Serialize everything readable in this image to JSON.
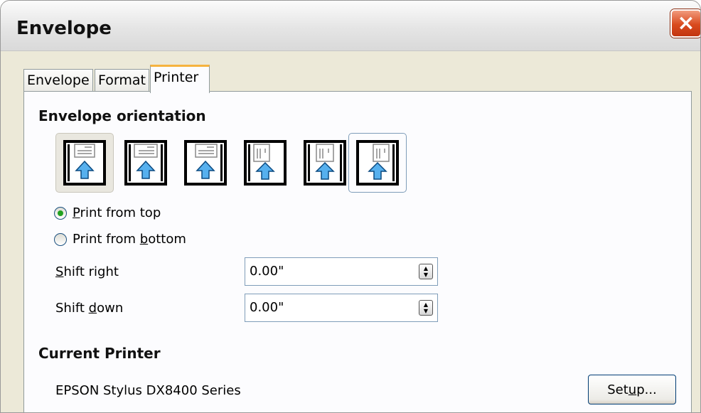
{
  "window": {
    "title": "Envelope",
    "close_icon": "close-icon"
  },
  "tabs": [
    {
      "label": "Envelope",
      "active": false
    },
    {
      "label": "Format",
      "active": false
    },
    {
      "label": "Printer",
      "active": true
    }
  ],
  "orientation": {
    "title": "Envelope orientation",
    "options": [
      {
        "name": "envelope-horizontal-left-icon",
        "selected": true
      },
      {
        "name": "envelope-horizontal-center-icon",
        "selected": false
      },
      {
        "name": "envelope-horizontal-right-icon",
        "selected": false
      },
      {
        "name": "envelope-vertical-left-icon",
        "selected": false
      },
      {
        "name": "envelope-vertical-center-icon",
        "selected": false
      },
      {
        "name": "envelope-vertical-right-icon",
        "selected": false
      }
    ]
  },
  "print_from": {
    "top": {
      "pre": "",
      "key": "P",
      "post": "rint from top",
      "checked": true
    },
    "bottom": {
      "pre": "Print from ",
      "key": "b",
      "post": "ottom",
      "checked": false
    }
  },
  "shift": {
    "right": {
      "pre": "",
      "key": "S",
      "post": "hift right",
      "value": "0.00\""
    },
    "down": {
      "pre": "Shift ",
      "key": "d",
      "post": "own",
      "value": "0.00\""
    }
  },
  "current_printer": {
    "title": "Current Printer",
    "name": "EPSON Stylus DX8400 Series",
    "setup": {
      "pre": "Set",
      "key": "u",
      "post": "p..."
    }
  },
  "colors": {
    "radio_dot": "#21a121",
    "arrow": "#2f8fd8",
    "active_tab_accent": "#f6b33f"
  }
}
